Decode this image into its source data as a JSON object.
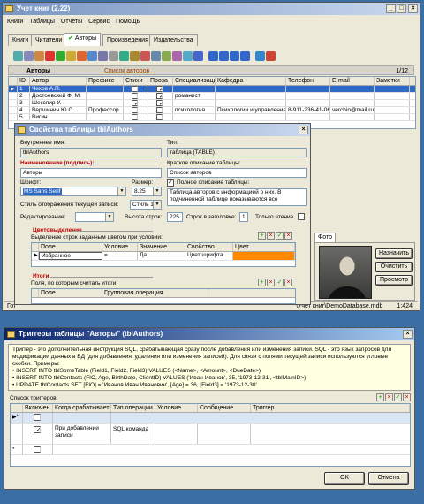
{
  "main": {
    "title": "Учет книг (2.22)",
    "menu": [
      "Книги",
      "Таблицы",
      "Отчеты",
      "Сервис",
      "Помощь"
    ],
    "tabs": [
      "Книги",
      "Читатели",
      "Авторы",
      "Произведения",
      "Издательства"
    ],
    "table_label": "Авторы",
    "table_caption": "Список авторов",
    "counter": "1/12",
    "columns": [
      "ID",
      "Автор",
      "Префикс",
      "Стихи",
      "Проза",
      "Специализация",
      "Кафедра",
      "Телефон",
      "E-mail",
      "Заметки"
    ],
    "rows": [
      {
        "id": "1",
        "name": "Чехов А.П.",
        "prefix": "",
        "poem": false,
        "prose": true,
        "spec": "",
        "dept": "",
        "phone": "",
        "email": ""
      },
      {
        "id": "2",
        "name": "Достоевский Ф. М.",
        "prefix": "",
        "poem": false,
        "prose": true,
        "spec": "романист",
        "dept": "",
        "phone": "",
        "email": ""
      },
      {
        "id": "3",
        "name": "Шекспир У.",
        "prefix": "",
        "poem": true,
        "prose": true,
        "spec": "",
        "dept": "",
        "phone": "",
        "email": ""
      },
      {
        "id": "4",
        "name": "Вершинин Ю.С.",
        "prefix": "Профессор",
        "poem": false,
        "prose": false,
        "spec": "психология",
        "dept": "Психологии и управления",
        "phone": "8-911-236-41-06",
        "email": "verchin@mail.ru"
      },
      {
        "id": "5",
        "name": "Вигин",
        "prefix": "",
        "poem": false,
        "prose": false,
        "spec": "",
        "dept": "",
        "phone": "",
        "email": ""
      }
    ],
    "status_path": "\\Учет книг\\DemoDatabase.mdb",
    "status_pos": "1:424",
    "status_left": "Гот"
  },
  "props": {
    "title": "Свойства таблицы tblAuthors",
    "internal_label": "Внутреннее имя:",
    "internal_value": "tblAuthors",
    "type_label": "Тип:",
    "type_value": "таблица (TABLE)",
    "name_label": "Наименование (подпись):",
    "name_value": "Авторы",
    "short_label": "Краткое описание таблицы:",
    "short_value": "Список авторов",
    "font_label": "Шрифт:",
    "font_value": "MS Sans Serif",
    "size_label": "Размер:",
    "size_value": "8.25",
    "full_label": "Полное описание таблицы:",
    "full_value": "Таблица авторов с информацией о них. В подчиненной таблице показываются все",
    "style_label": "Стиль отображения текущей записи:",
    "style_value": "Стиль 1",
    "edit_label": "Редактирование:",
    "row_height_label": "Высота строк:",
    "row_height_value": "225",
    "header_rows_label": "Строк в заголовке:",
    "header_rows_value": "1",
    "readonly_label": "Только чтение",
    "photo_tab": "Фото",
    "color_section": "Цветовыделение",
    "color_desc": "Выделение строк заданным цветом при условии:",
    "color_cols": [
      "Поле",
      "Условие",
      "Значение",
      "Свойство",
      "Цвет"
    ],
    "color_row": {
      "field": "Избранное",
      "cond": "=",
      "value": "Да",
      "prop": "Цвет шрифта",
      "color": "#ff8800"
    },
    "totals_section": "Итоги",
    "totals_desc": "Поля, по которым считать итоги:",
    "totals_cols": [
      "Поле",
      "Групповая операция"
    ],
    "btn_assign": "Назначить",
    "btn_clear": "Очистить",
    "btn_view": "Просмотр"
  },
  "triggers": {
    "title": "Триггеры таблицы \"Авторы\" (tblAuthors)",
    "desc": [
      "Триггер - это дополнительная инструкция SQL, срабатывающая сразу после добавления или изменения записи. SQL - это язык запросов для модификации данных в БД (для добавления, удаления или изменения записей). Для связи с полями текущей записи используются угловые скобки. Примеры:",
      "• INSERT INTO tblSomeTable (Field1, Field2, Field3) VALUES (<Name>, <Amount>, <DueDate>)",
      "• INSERT INTO tblContacts (FIO, Age, BirthDate, ClientID) VALUES ('Иван Иванов', 35, '1973-12-31', <tblMainID>)",
      "• UPDATE tblContacts SET [FIO] = 'Иванов Иван Иванович', [Age] = 36, [Field3] = '1973-12-30'"
    ],
    "list_label": "Список триггеров:",
    "cols": [
      "Включен",
      "Когда срабатывает",
      "Тип операции",
      "Условие",
      "Сообщение",
      "Триггер"
    ],
    "row": {
      "enabled": true,
      "when": "При добавлении записи",
      "op": "SQL команда"
    },
    "ok": "OK",
    "cancel": "Отмена"
  },
  "colors": {
    "desktop": "#3a6ea5",
    "title_active": "#0a246a",
    "highlight": "#316ac5",
    "orange": "#ff8800"
  }
}
